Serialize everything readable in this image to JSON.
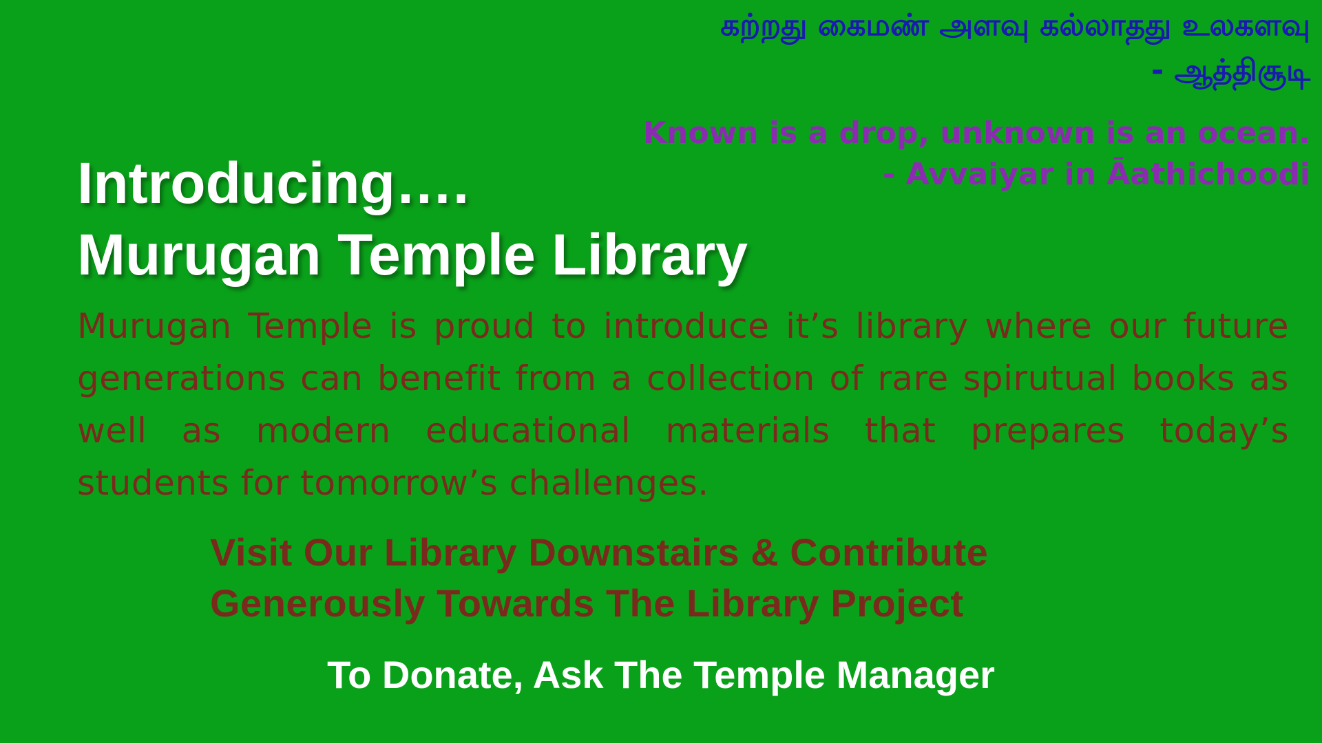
{
  "quote": {
    "tamil_line": "கற்றது கைமண் அளவு கல்லாதது உலகளவு",
    "tamil_attribution": "- ஆத்திசூடி",
    "english_line": "Known is a drop, unknown is an ocean.",
    "english_attribution": "- Avvaiyar in Āathichoodi"
  },
  "headline": {
    "line1": "Introducing….",
    "line2": "Murugan Temple Library"
  },
  "intro_paragraph": "Murugan Temple is proud to introduce it’s library where our future generations can benefit from a collection of rare spirutual books as well as modern educational materials that prepares today’s students for tomorrow’s challenges.",
  "call_to_action": {
    "line1": "Visit Our Library Downstairs & Contribute",
    "line2": "Generously Towards The Library Project"
  },
  "donate_line": "To Donate, Ask The Temple Manager",
  "colors": {
    "background": "#0aa11a",
    "tamil_quote": "#1a1ab0",
    "english_quote": "#8b2cb0",
    "headline": "#ffffff",
    "body_text": "#7a2a1c"
  }
}
